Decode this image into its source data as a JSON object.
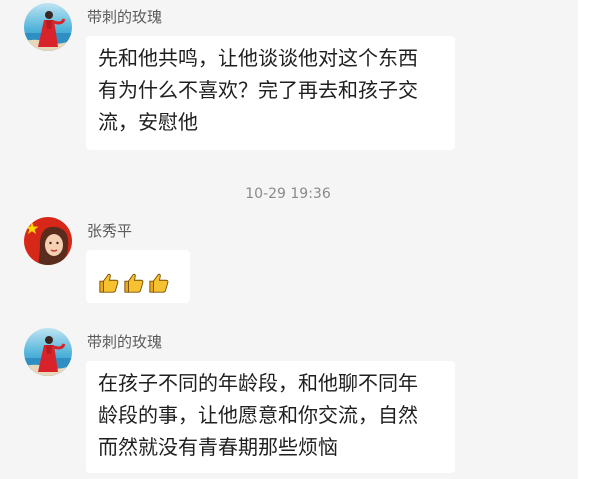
{
  "messages": [
    {
      "sender": "带刺的玫瑰",
      "lines": [
        "先和他共鸣，让他谈谈他对这个东西",
        "有为什么不喜欢？完了再去和孩子交",
        "流，安慰他"
      ]
    },
    {
      "sender": "张秀平",
      "reaction": "👍👍👍"
    },
    {
      "sender": "带刺的玫瑰",
      "lines": [
        "在孩子不同的年龄段，和他聊不同年",
        "龄段的事，让他愿意和你交流，自然",
        "而然就没有青春期那些烦恼"
      ]
    }
  ],
  "timestamp": "10-29 19:36",
  "colors": {
    "background": "#f5f5f5",
    "bubble": "#ffffff",
    "sender_text": "#5c5c5c",
    "timestamp_text": "#8a8a8a",
    "thumb_yellow": "#f7c232"
  },
  "icons": {
    "reaction_icon": "thumbs-up-icon"
  }
}
